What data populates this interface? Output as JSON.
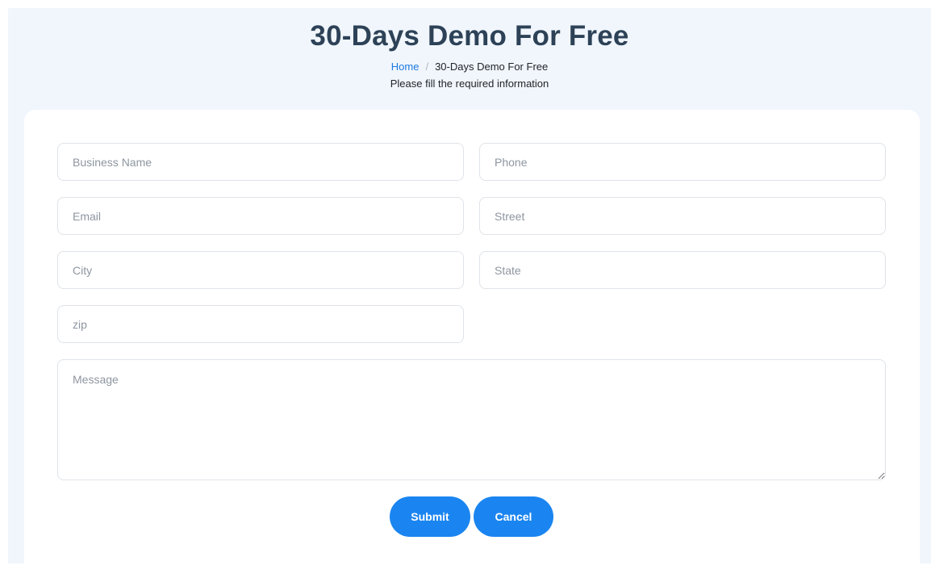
{
  "header": {
    "title": "30-Days Demo For Free",
    "breadcrumb": {
      "home": "Home",
      "separator": "/",
      "current": "30-Days Demo For Free"
    },
    "instruction": "Please fill the required information"
  },
  "form": {
    "business_name": {
      "placeholder": "Business Name",
      "value": ""
    },
    "phone": {
      "placeholder": "Phone",
      "value": ""
    },
    "email": {
      "placeholder": "Email",
      "value": ""
    },
    "street": {
      "placeholder": "Street",
      "value": ""
    },
    "city": {
      "placeholder": "City",
      "value": ""
    },
    "state": {
      "placeholder": "State",
      "value": ""
    },
    "zip": {
      "placeholder": "zip",
      "value": ""
    },
    "message": {
      "placeholder": "Message",
      "value": ""
    },
    "submit_label": "Submit",
    "cancel_label": "Cancel"
  },
  "colors": {
    "page_background": "#f1f6fd",
    "title": "#2d4257",
    "link": "#1e7ae0",
    "button": "#1a85f0"
  }
}
